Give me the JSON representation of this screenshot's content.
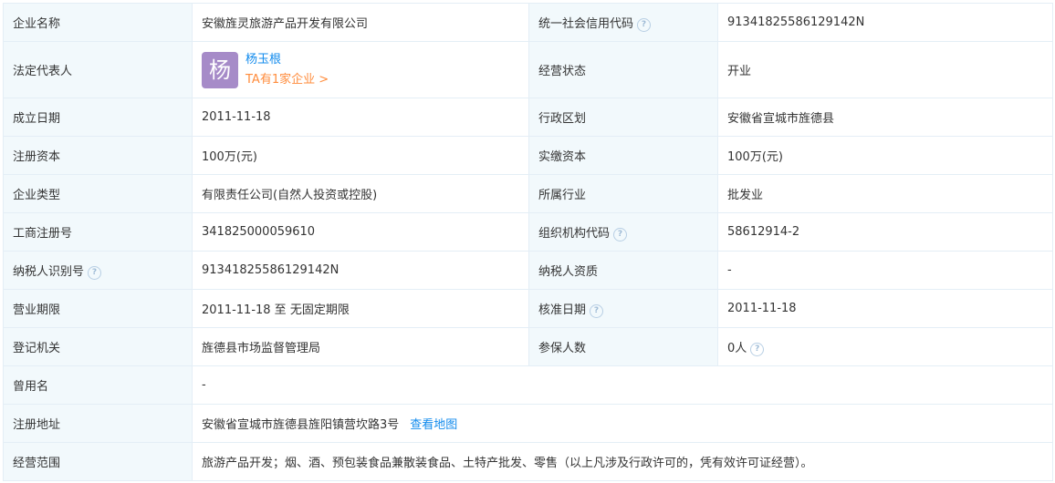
{
  "rows": {
    "company_name": {
      "label": "企业名称",
      "value": "安徽旌灵旅游产品开发有限公司"
    },
    "credit_code": {
      "label": "统一社会信用代码",
      "value": "91341825586129142N",
      "icon": "help-icon"
    },
    "legal_rep": {
      "label": "法定代表人",
      "avatar_char": "杨",
      "name": "杨玉根",
      "more_link": "TA有1家企业 >",
      "avatar_color": "#a68bc8"
    },
    "status": {
      "label": "经营状态",
      "value": "开业"
    },
    "established": {
      "label": "成立日期",
      "value": "2011-11-18"
    },
    "region": {
      "label": "行政区划",
      "value": "安徽省宣城市旌德县"
    },
    "reg_capital": {
      "label": "注册资本",
      "value": "100万(元)"
    },
    "paid_capital": {
      "label": "实缴资本",
      "value": "100万(元)"
    },
    "company_type": {
      "label": "企业类型",
      "value": "有限责任公司(自然人投资或控股)"
    },
    "industry": {
      "label": "所属行业",
      "value": "批发业"
    },
    "reg_number": {
      "label": "工商注册号",
      "value": "341825000059610"
    },
    "org_code": {
      "label": "组织机构代码",
      "value": "58612914-2",
      "icon": "help-icon"
    },
    "taxpayer_id": {
      "label": "纳税人识别号",
      "value": "91341825586129142N",
      "icon": "help-icon"
    },
    "taxpayer_qual": {
      "label": "纳税人资质",
      "value": "-"
    },
    "business_term": {
      "label": "营业期限",
      "value": "2011-11-18 至 无固定期限"
    },
    "approval_date": {
      "label": "核准日期",
      "value": "2011-11-18",
      "icon": "help-icon"
    },
    "authority": {
      "label": "登记机关",
      "value": "旌德县市场监督管理局"
    },
    "insured": {
      "label": "参保人数",
      "value": "0人",
      "icon": "help-icon"
    },
    "former_name": {
      "label": "曾用名",
      "value": "-"
    },
    "address": {
      "label": "注册地址",
      "value": "安徽省宣城市旌德县旌阳镇营坎路3号",
      "map_link": "查看地图"
    },
    "scope": {
      "label": "经营范围",
      "value": "旅游产品开发；烟、酒、预包装食品兼散装食品、土特产批发、零售（以上凡涉及行政许可的，凭有效许可证经营）。"
    }
  },
  "colors": {
    "label_bg": "#f2f9fc",
    "border": "#e4eef6",
    "link": "#128bed",
    "orange_link": "#ff8c3c"
  }
}
